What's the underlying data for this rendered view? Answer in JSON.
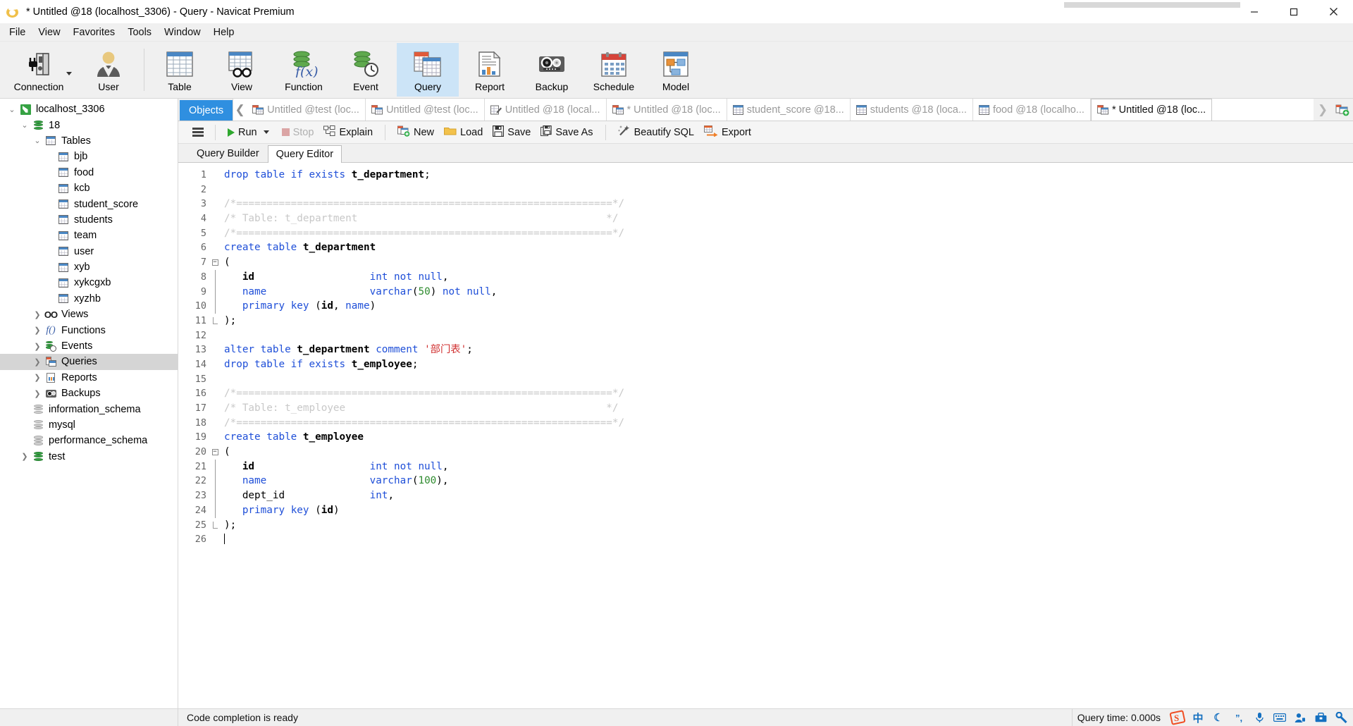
{
  "window": {
    "title": "* Untitled @18 (localhost_3306) - Query - Navicat Premium",
    "app_icon": "navicat-logo-icon",
    "minimize_label": "Minimize",
    "maximize_label": "Maximize",
    "close_label": "Close"
  },
  "menubar": {
    "items": [
      {
        "label": "File"
      },
      {
        "label": "View"
      },
      {
        "label": "Favorites"
      },
      {
        "label": "Tools"
      },
      {
        "label": "Window"
      },
      {
        "label": "Help"
      }
    ]
  },
  "toolbar": {
    "items": [
      {
        "label": "Connection",
        "icon": "connection-plug-icon",
        "active": false,
        "has_caret": true
      },
      {
        "label": "User",
        "icon": "user-icon",
        "active": false,
        "has_caret": false
      },
      {
        "label": "Table",
        "icon": "table-icon",
        "active": false,
        "has_caret": false
      },
      {
        "label": "View",
        "icon": "view-glasses-icon",
        "active": false,
        "has_caret": false
      },
      {
        "label": "Function",
        "icon": "function-fx-icon",
        "active": false,
        "has_caret": false
      },
      {
        "label": "Event",
        "icon": "event-clock-icon",
        "active": false,
        "has_caret": false
      },
      {
        "label": "Query",
        "icon": "query-tables-icon",
        "active": true,
        "has_caret": false
      },
      {
        "label": "Report",
        "icon": "report-document-icon",
        "active": false,
        "has_caret": false
      },
      {
        "label": "Backup",
        "icon": "backup-tape-icon",
        "active": false,
        "has_caret": false
      },
      {
        "label": "Schedule",
        "icon": "schedule-calendar-icon",
        "active": false,
        "has_caret": false
      },
      {
        "label": "Model",
        "icon": "model-diagram-icon",
        "active": false,
        "has_caret": false
      }
    ]
  },
  "sidebar": {
    "items": [
      {
        "label": "localhost_3306",
        "indent": 0,
        "twisty": "open",
        "icon": "connection-icon",
        "selected": false
      },
      {
        "label": "18",
        "indent": 1,
        "twisty": "open",
        "icon": "database-green-icon",
        "selected": false
      },
      {
        "label": "Tables",
        "indent": 2,
        "twisty": "open",
        "icon": "tables-folder-icon",
        "selected": false
      },
      {
        "label": "bjb",
        "indent": 3,
        "twisty": "none",
        "icon": "table-icon",
        "selected": false
      },
      {
        "label": "food",
        "indent": 3,
        "twisty": "none",
        "icon": "table-icon",
        "selected": false
      },
      {
        "label": "kcb",
        "indent": 3,
        "twisty": "none",
        "icon": "table-icon",
        "selected": false
      },
      {
        "label": "student_score",
        "indent": 3,
        "twisty": "none",
        "icon": "table-icon",
        "selected": false
      },
      {
        "label": "students",
        "indent": 3,
        "twisty": "none",
        "icon": "table-icon",
        "selected": false
      },
      {
        "label": "team",
        "indent": 3,
        "twisty": "none",
        "icon": "table-icon",
        "selected": false
      },
      {
        "label": "user",
        "indent": 3,
        "twisty": "none",
        "icon": "table-icon",
        "selected": false
      },
      {
        "label": "xyb",
        "indent": 3,
        "twisty": "none",
        "icon": "table-icon",
        "selected": false
      },
      {
        "label": "xykcgxb",
        "indent": 3,
        "twisty": "none",
        "icon": "table-icon",
        "selected": false
      },
      {
        "label": "xyzhb",
        "indent": 3,
        "twisty": "none",
        "icon": "table-icon",
        "selected": false
      },
      {
        "label": "Views",
        "indent": 2,
        "twisty": "closed",
        "icon": "views-icon",
        "selected": false
      },
      {
        "label": "Functions",
        "indent": 2,
        "twisty": "closed",
        "icon": "functions-icon",
        "selected": false
      },
      {
        "label": "Events",
        "indent": 2,
        "twisty": "closed",
        "icon": "events-icon",
        "selected": false
      },
      {
        "label": "Queries",
        "indent": 2,
        "twisty": "closed",
        "icon": "queries-icon",
        "selected": true
      },
      {
        "label": "Reports",
        "indent": 2,
        "twisty": "closed",
        "icon": "reports-icon",
        "selected": false
      },
      {
        "label": "Backups",
        "indent": 2,
        "twisty": "closed",
        "icon": "backups-icon",
        "selected": false
      },
      {
        "label": "information_schema",
        "indent": 1,
        "twisty": "none",
        "icon": "database-gray-icon",
        "selected": false
      },
      {
        "label": "mysql",
        "indent": 1,
        "twisty": "none",
        "icon": "database-gray-icon",
        "selected": false
      },
      {
        "label": "performance_schema",
        "indent": 1,
        "twisty": "none",
        "icon": "database-gray-icon",
        "selected": false
      },
      {
        "label": "test",
        "indent": 1,
        "twisty": "closed",
        "icon": "database-green-icon",
        "selected": false
      }
    ]
  },
  "tabstrip": {
    "objects_label": "Objects",
    "scroll_left_icon": "chevron-left-icon",
    "scroll_right_icon": "chevron-right-icon",
    "new_tab_icon": "new-query-plus-icon",
    "tabs": [
      {
        "label": "Untitled @test (loc...",
        "icon": "query-icon",
        "active": false
      },
      {
        "label": "Untitled @test (loc...",
        "icon": "query-icon",
        "active": false
      },
      {
        "label": "Untitled @18 (local...",
        "icon": "design-icon",
        "active": false
      },
      {
        "label": "* Untitled @18 (loc...",
        "icon": "query-icon",
        "active": false
      },
      {
        "label": "student_score @18...",
        "icon": "table-icon",
        "active": false
      },
      {
        "label": "students @18 (loca...",
        "icon": "table-icon",
        "active": false
      },
      {
        "label": "food @18 (localho...",
        "icon": "table-icon",
        "active": false
      },
      {
        "label": "* Untitled @18 (loc...",
        "icon": "query-icon",
        "active": true
      }
    ]
  },
  "query_toolbar": {
    "menu_icon": "hamburger-menu-icon",
    "buttons": [
      {
        "label": "Run",
        "icon": "play-icon",
        "disabled": false,
        "caret": true
      },
      {
        "label": "Stop",
        "icon": "stop-icon",
        "disabled": true,
        "caret": false
      },
      {
        "label": "Explain",
        "icon": "explain-icon",
        "disabled": false,
        "caret": false
      },
      {
        "label": "New",
        "icon": "new-query-icon",
        "disabled": false,
        "caret": false
      },
      {
        "label": "Load",
        "icon": "folder-icon",
        "disabled": false,
        "caret": false
      },
      {
        "label": "Save",
        "icon": "save-disk-icon",
        "disabled": false,
        "caret": false
      },
      {
        "label": "Save As",
        "icon": "save-as-icon",
        "disabled": false,
        "caret": false
      },
      {
        "label": "Beautify SQL",
        "icon": "magic-wand-icon",
        "disabled": false,
        "caret": false
      },
      {
        "label": "Export",
        "icon": "export-arrow-icon",
        "disabled": false,
        "caret": false
      }
    ]
  },
  "subtabs": [
    {
      "label": "Query Builder",
      "active": false
    },
    {
      "label": "Query Editor",
      "active": true
    }
  ],
  "editor": {
    "total_lines": 26,
    "lines": [
      {
        "n": 1,
        "fold": "none",
        "tokens": [
          {
            "t": "drop table if exists ",
            "c": "kw"
          },
          {
            "t": "t_department",
            "c": "id"
          },
          {
            "t": ";",
            "c": "plain"
          }
        ]
      },
      {
        "n": 2,
        "fold": "none",
        "tokens": []
      },
      {
        "n": 3,
        "fold": "none",
        "tokens": [
          {
            "t": "/*==============================================================*/",
            "c": "cmt"
          }
        ]
      },
      {
        "n": 4,
        "fold": "none",
        "tokens": [
          {
            "t": "/* Table: t_department                                         */",
            "c": "cmt"
          }
        ]
      },
      {
        "n": 5,
        "fold": "none",
        "tokens": [
          {
            "t": "/*==============================================================*/",
            "c": "cmt"
          }
        ]
      },
      {
        "n": 6,
        "fold": "none",
        "tokens": [
          {
            "t": "create table ",
            "c": "kw"
          },
          {
            "t": "t_department",
            "c": "id"
          }
        ]
      },
      {
        "n": 7,
        "fold": "start",
        "tokens": [
          {
            "t": "(",
            "c": "plain"
          }
        ]
      },
      {
        "n": 8,
        "fold": "line",
        "tokens": [
          {
            "t": "   ",
            "c": "plain"
          },
          {
            "t": "id",
            "c": "id"
          },
          {
            "t": "                   ",
            "c": "plain"
          },
          {
            "t": "int not null",
            "c": "kw"
          },
          {
            "t": ",",
            "c": "plain"
          }
        ]
      },
      {
        "n": 9,
        "fold": "line",
        "tokens": [
          {
            "t": "   ",
            "c": "plain"
          },
          {
            "t": "name",
            "c": "kw"
          },
          {
            "t": "                 ",
            "c": "plain"
          },
          {
            "t": "varchar",
            "c": "kw"
          },
          {
            "t": "(",
            "c": "plain"
          },
          {
            "t": "50",
            "c": "num"
          },
          {
            "t": ") ",
            "c": "plain"
          },
          {
            "t": "not null",
            "c": "kw"
          },
          {
            "t": ",",
            "c": "plain"
          }
        ]
      },
      {
        "n": 10,
        "fold": "line",
        "tokens": [
          {
            "t": "   ",
            "c": "plain"
          },
          {
            "t": "primary key ",
            "c": "kw"
          },
          {
            "t": "(",
            "c": "plain"
          },
          {
            "t": "id",
            "c": "id"
          },
          {
            "t": ", ",
            "c": "plain"
          },
          {
            "t": "name",
            "c": "kw"
          },
          {
            "t": ")",
            "c": "plain"
          }
        ]
      },
      {
        "n": 11,
        "fold": "end",
        "tokens": [
          {
            "t": ");",
            "c": "plain"
          }
        ]
      },
      {
        "n": 12,
        "fold": "none",
        "tokens": []
      },
      {
        "n": 13,
        "fold": "none",
        "tokens": [
          {
            "t": "alter table ",
            "c": "kw"
          },
          {
            "t": "t_department",
            "c": "id"
          },
          {
            "t": " ",
            "c": "plain"
          },
          {
            "t": "comment",
            "c": "kw"
          },
          {
            "t": " ",
            "c": "plain"
          },
          {
            "t": "'部门表'",
            "c": "str"
          },
          {
            "t": ";",
            "c": "plain"
          }
        ]
      },
      {
        "n": 14,
        "fold": "none",
        "tokens": [
          {
            "t": "drop table if exists ",
            "c": "kw"
          },
          {
            "t": "t_employee",
            "c": "id"
          },
          {
            "t": ";",
            "c": "plain"
          }
        ]
      },
      {
        "n": 15,
        "fold": "none",
        "tokens": []
      },
      {
        "n": 16,
        "fold": "none",
        "tokens": [
          {
            "t": "/*==============================================================*/",
            "c": "cmt"
          }
        ]
      },
      {
        "n": 17,
        "fold": "none",
        "tokens": [
          {
            "t": "/* Table: t_employee                                           */",
            "c": "cmt"
          }
        ]
      },
      {
        "n": 18,
        "fold": "none",
        "tokens": [
          {
            "t": "/*==============================================================*/",
            "c": "cmt"
          }
        ]
      },
      {
        "n": 19,
        "fold": "none",
        "tokens": [
          {
            "t": "create table ",
            "c": "kw"
          },
          {
            "t": "t_employee",
            "c": "id"
          }
        ]
      },
      {
        "n": 20,
        "fold": "start",
        "tokens": [
          {
            "t": "(",
            "c": "plain"
          }
        ]
      },
      {
        "n": 21,
        "fold": "line",
        "tokens": [
          {
            "t": "   ",
            "c": "plain"
          },
          {
            "t": "id",
            "c": "id"
          },
          {
            "t": "                   ",
            "c": "plain"
          },
          {
            "t": "int not null",
            "c": "kw"
          },
          {
            "t": ",",
            "c": "plain"
          }
        ]
      },
      {
        "n": 22,
        "fold": "line",
        "tokens": [
          {
            "t": "   ",
            "c": "plain"
          },
          {
            "t": "name",
            "c": "kw"
          },
          {
            "t": "                 ",
            "c": "plain"
          },
          {
            "t": "varchar",
            "c": "kw"
          },
          {
            "t": "(",
            "c": "plain"
          },
          {
            "t": "100",
            "c": "num"
          },
          {
            "t": "),",
            "c": "plain"
          }
        ]
      },
      {
        "n": 23,
        "fold": "line",
        "tokens": [
          {
            "t": "   ",
            "c": "plain"
          },
          {
            "t": "dept_id",
            "c": "plain"
          },
          {
            "t": "              ",
            "c": "plain"
          },
          {
            "t": "int",
            "c": "kw"
          },
          {
            "t": ",",
            "c": "plain"
          }
        ]
      },
      {
        "n": 24,
        "fold": "line",
        "tokens": [
          {
            "t": "   ",
            "c": "plain"
          },
          {
            "t": "primary key ",
            "c": "kw"
          },
          {
            "t": "(",
            "c": "plain"
          },
          {
            "t": "id",
            "c": "id"
          },
          {
            "t": ")",
            "c": "plain"
          }
        ]
      },
      {
        "n": 25,
        "fold": "end",
        "tokens": [
          {
            "t": ");",
            "c": "plain"
          }
        ]
      },
      {
        "n": 26,
        "fold": "none",
        "tokens": [],
        "caret": true
      }
    ]
  },
  "statusbar": {
    "message": "Code completion is ready",
    "query_time": "Query time: 0.000s",
    "tray_icons": [
      {
        "name": "sogou-ime-icon",
        "glyph": "S"
      },
      {
        "name": "chinese-mode-icon",
        "glyph": "中"
      },
      {
        "name": "moon-icon",
        "glyph": "☾"
      },
      {
        "name": "punctuation-icon",
        "glyph": "”,"
      },
      {
        "name": "microphone-icon",
        "glyph": "🎤"
      },
      {
        "name": "keyboard-icon",
        "glyph": "⌨"
      },
      {
        "name": "user-switch-icon",
        "glyph": "👤"
      },
      {
        "name": "toolbox-icon",
        "glyph": "🧰"
      },
      {
        "name": "settings-icon",
        "glyph": "🔧"
      }
    ]
  },
  "colors": {
    "accent": "#2f8fe0",
    "toolbar_active": "#cce4f7",
    "keyword": "#1f4fd8",
    "string": "#d03030",
    "number": "#2e8b2e",
    "comment": "#c8c8c8"
  }
}
